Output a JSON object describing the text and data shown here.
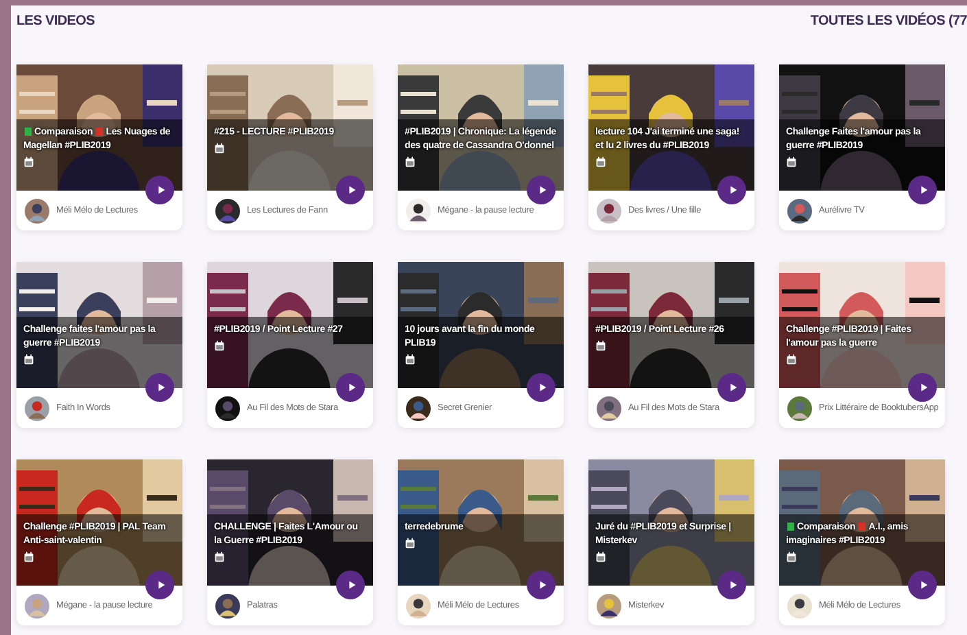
{
  "header": {
    "title": "LES VIDEOS",
    "all_link": "TOUTES LES VIDÉOS (77"
  },
  "videos": [
    {
      "title": [
        {
          "color": "#2fb344",
          "text": "Comparaison"
        },
        {
          "color": "#d93025",
          "text": "Les Nuages de Magellan #PLIB2019"
        }
      ],
      "channel": "Méli Mélo de Lectures"
    },
    {
      "title": [
        {
          "text": "#215 - LECTURE #PLIB2019"
        }
      ],
      "channel": "Les Lectures de Fann"
    },
    {
      "title": [
        {
          "text": "#PLIB2019 | Chronique: La légende des quatre de Cassandra O'donnel"
        }
      ],
      "channel": "Mégane - la pause lecture"
    },
    {
      "title": [
        {
          "text": "lecture 104 J'ai terminé une saga! et lu 2 livres du #PLIB2019"
        }
      ],
      "channel": "Des livres / Une fille"
    },
    {
      "title": [
        {
          "text": "Challenge Faites l'amour pas la guerre #PLIB2019"
        }
      ],
      "channel": "Aurélivre TV"
    },
    {
      "title": [
        {
          "text": "Challenge faites l'amour pas la guerre #PLIB2019"
        }
      ],
      "channel": "Faith In Words"
    },
    {
      "title": [
        {
          "text": "#PLIB2019 / Point Lecture #27"
        }
      ],
      "channel": "Au Fil des Mots de Stara"
    },
    {
      "title": [
        {
          "text": "10 jours avant la fin du monde PLIB19"
        }
      ],
      "channel": "Secret Grenier"
    },
    {
      "title": [
        {
          "text": "#PLIB2019 / Point Lecture #26"
        }
      ],
      "channel": "Au Fil des Mots de Stara"
    },
    {
      "title": [
        {
          "text": "Challenge #PLIB2019 | Faites l'amour pas la guerre"
        }
      ],
      "channel": "Prix Littéraire de BooktubersApp"
    },
    {
      "title": [
        {
          "text": "Challenge #PLIB2019 | PAL Team Anti-saint-valentin"
        }
      ],
      "channel": "Mégane - la pause lecture"
    },
    {
      "title": [
        {
          "text": "CHALLENGE | Faites L'Amour ou la Guerre #PLIB2019"
        }
      ],
      "channel": "Palatras"
    },
    {
      "title": [
        {
          "text": "terredebrume"
        }
      ],
      "channel": "Méli Mélo de Lectures"
    },
    {
      "title": [
        {
          "text": "Juré du #PLIB2019 et Surprise | Misterkev"
        }
      ],
      "channel": "Misterkev"
    },
    {
      "title": [
        {
          "color": "#2fb344",
          "text": "Comparaison"
        },
        {
          "color": "#d93025",
          "text": "A.I., amis imaginaires #PLIB2019"
        }
      ],
      "channel": "Méli Mélo de Lectures"
    }
  ]
}
